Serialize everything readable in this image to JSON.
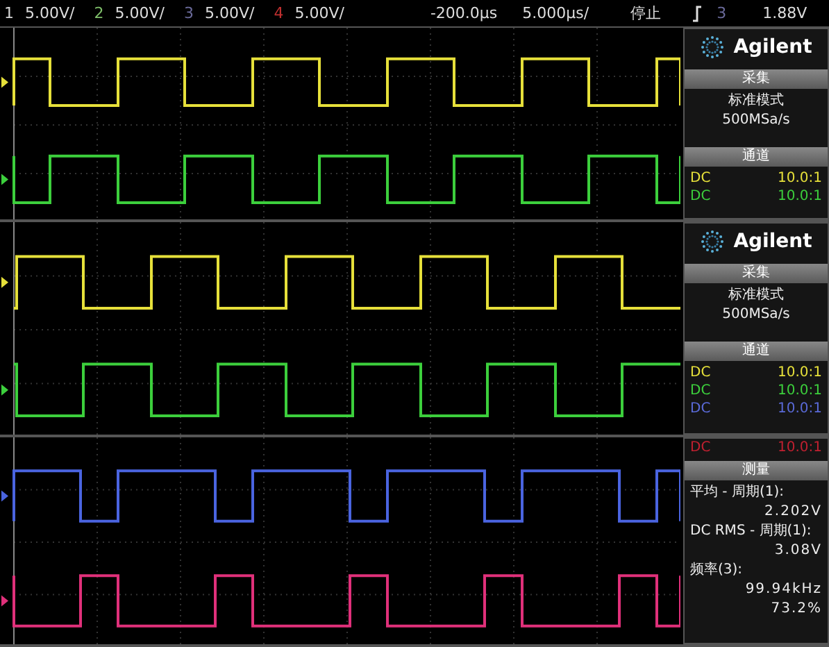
{
  "top_bar": {
    "channels": [
      {
        "number": "1",
        "scale": "5.00V/",
        "color": "#d8d8d8"
      },
      {
        "number": "2",
        "scale": "5.00V/",
        "color": "#7fbf6a"
      },
      {
        "number": "3",
        "scale": "5.00V/",
        "color": "#6a6a9a"
      },
      {
        "number": "4",
        "scale": "5.00V/",
        "color": "#c03030"
      }
    ],
    "delay": "-200.0µs",
    "timebase": "5.000µs/",
    "run_state": "停止",
    "trigger_source": "3",
    "trigger_level": "1.88V"
  },
  "screens": [
    {
      "traces": [
        {
          "color": "#e6e03a",
          "inverted": false
        },
        {
          "color": "#3ccf3c",
          "inverted": true
        }
      ],
      "side_panel": {
        "brand": "Agilent",
        "rows": [
          {
            "kind": "header",
            "text": "采集"
          },
          {
            "kind": "text",
            "text": "标准模式"
          },
          {
            "kind": "text",
            "text": "500MSa/s"
          },
          {
            "kind": "header",
            "text": "通道"
          },
          {
            "kind": "channel",
            "coupling": "DC",
            "ratio": "10.0:1",
            "color": "#e6e03a"
          },
          {
            "kind": "channel",
            "coupling": "DC",
            "ratio": "10.0:1",
            "color": "#3ccf3c"
          }
        ]
      }
    },
    {
      "traces": [
        {
          "color": "#e6e03a",
          "inverted": false
        },
        {
          "color": "#3ccf3c",
          "inverted": true
        }
      ],
      "side_panel": {
        "brand": "Agilent",
        "rows": [
          {
            "kind": "header",
            "text": "采集"
          },
          {
            "kind": "text",
            "text": "标准模式"
          },
          {
            "kind": "text",
            "text": "500MSa/s"
          },
          {
            "kind": "header",
            "text": "通道"
          },
          {
            "kind": "channel",
            "coupling": "DC",
            "ratio": "10.0:1",
            "color": "#e6e03a"
          },
          {
            "kind": "channel",
            "coupling": "DC",
            "ratio": "10.0:1",
            "color": "#3ccf3c"
          },
          {
            "kind": "channel",
            "coupling": "DC",
            "ratio": "10.0:1",
            "color": "#5a6ad8"
          }
        ]
      }
    },
    {
      "traces": [
        {
          "color": "#4a64e0",
          "inverted": false
        },
        {
          "color": "#e0307a",
          "inverted": true
        }
      ],
      "side_panel": {
        "rows": [
          {
            "kind": "channel",
            "coupling": "DC",
            "ratio": "10.0:1",
            "color": "#c02030"
          },
          {
            "kind": "header",
            "text": "测量"
          },
          {
            "kind": "label",
            "text": "平均 - 周期(1):"
          },
          {
            "kind": "value",
            "text": "2.202V"
          },
          {
            "kind": "label",
            "text": "DC RMS - 周期(1):"
          },
          {
            "kind": "value",
            "text": "3.08V"
          },
          {
            "kind": "label",
            "text": "频率(3):"
          },
          {
            "kind": "value",
            "text": "99.94kHz"
          },
          {
            "kind": "value",
            "text": "73.2%"
          }
        ]
      }
    }
  ]
}
